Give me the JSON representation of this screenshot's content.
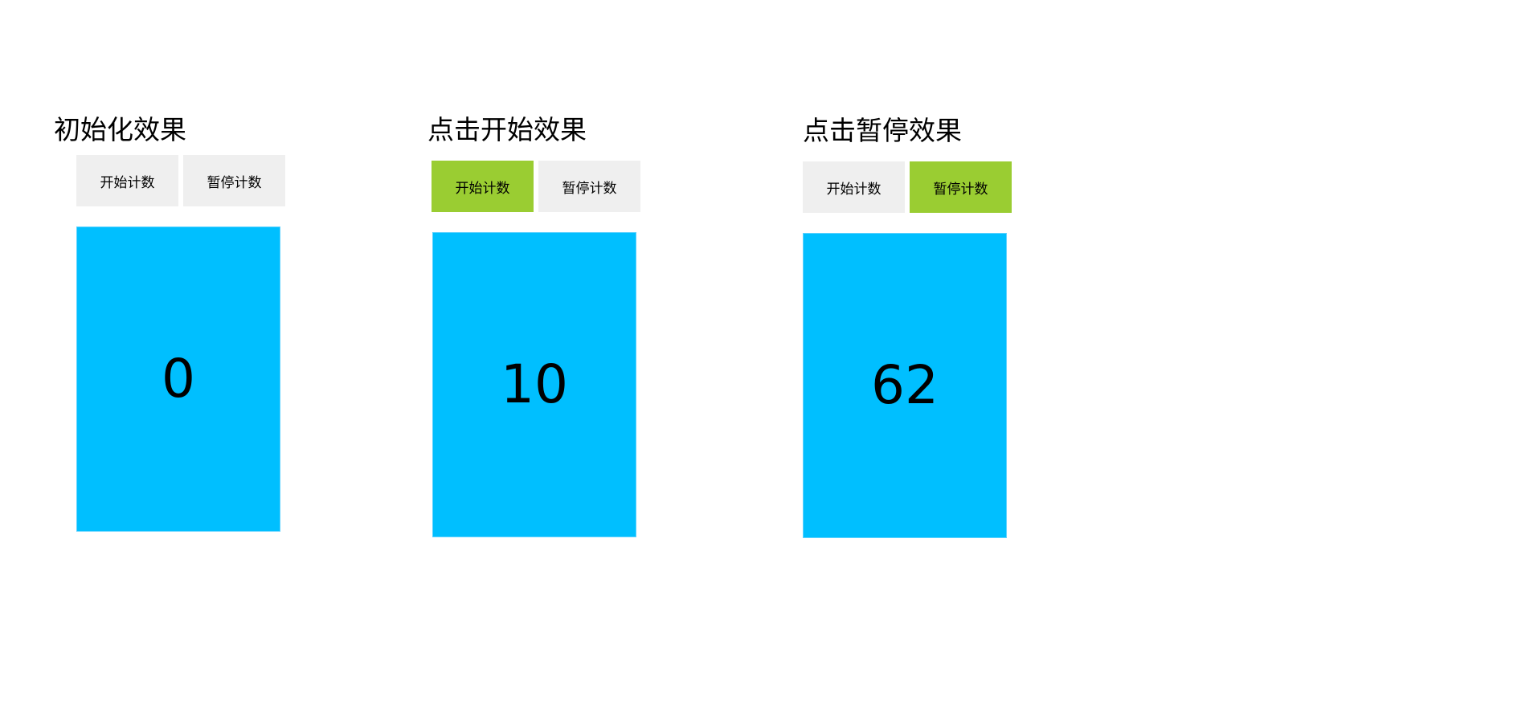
{
  "panels": [
    {
      "title": "初始化效果",
      "buttons": {
        "start_label": "开始计数",
        "pause_label": "暂停计数"
      },
      "active_button": "none",
      "counter_value": "0"
    },
    {
      "title": "点击开始效果",
      "buttons": {
        "start_label": "开始计数",
        "pause_label": "暂停计数"
      },
      "active_button": "start",
      "counter_value": "10"
    },
    {
      "title": "点击暂停效果",
      "buttons": {
        "start_label": "开始计数",
        "pause_label": "暂停计数"
      },
      "active_button": "pause",
      "counter_value": "62"
    }
  ],
  "colors": {
    "button_default": "#efefef",
    "button_active": "#9acd32",
    "counter_background": "#00bfff",
    "counter_border": "#5fd2ff"
  }
}
